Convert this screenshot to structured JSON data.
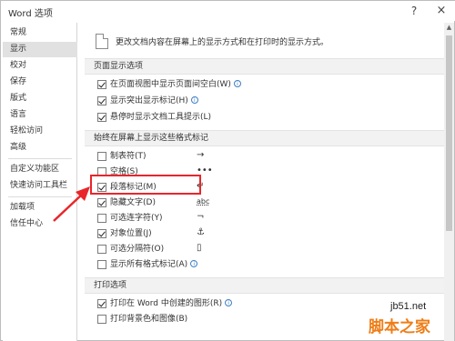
{
  "window": {
    "title": "Word 选项",
    "help_glyph": "?",
    "close_glyph": "×"
  },
  "sidebar": {
    "items": [
      {
        "label": "常规",
        "active": false
      },
      {
        "label": "显示",
        "active": true
      },
      {
        "label": "校对",
        "active": false
      },
      {
        "label": "保存",
        "active": false
      },
      {
        "label": "版式",
        "active": false
      },
      {
        "label": "语言",
        "active": false
      },
      {
        "label": "轻松访问",
        "active": false
      },
      {
        "label": "高级",
        "active": false
      },
      {
        "label": "自定义功能区",
        "active": false
      },
      {
        "label": "快速访问工具栏",
        "active": false
      },
      {
        "label": "加载项",
        "active": false
      },
      {
        "label": "信任中心",
        "active": false
      }
    ]
  },
  "content": {
    "intro": "更改文档内容在屏幕上的显示方式和在打印时的显示方式。",
    "sections": {
      "page_display": {
        "title": "页面显示选项",
        "options": [
          {
            "label": "在页面视图中显示页面间空白(W)",
            "checked": true,
            "info": true
          },
          {
            "label": "显示突出显示标记(H)",
            "checked": true,
            "info": true
          },
          {
            "label": "悬停时显示文档工具提示(L)",
            "checked": true,
            "info": false
          }
        ]
      },
      "format_marks": {
        "title": "始终在屏幕上显示这些格式标记",
        "options": [
          {
            "label": "制表符(T)",
            "checked": false,
            "symbol": "→"
          },
          {
            "label": "空格(S)",
            "checked": false,
            "symbol": "•••"
          },
          {
            "label": "段落标记(M)",
            "checked": true,
            "symbol": "↵"
          },
          {
            "label": "隐藏文字(D)",
            "checked": true,
            "symbol": "abc"
          },
          {
            "label": "可选连字符(Y)",
            "checked": false,
            "symbol": "¬"
          },
          {
            "label": "对象位置(J)",
            "checked": true,
            "symbol": "⚓"
          },
          {
            "label": "可选分隔符(O)",
            "checked": false,
            "symbol": "▯"
          },
          {
            "label": "显示所有格式标记(A)",
            "checked": false,
            "info": true
          }
        ]
      },
      "print": {
        "title": "打印选项",
        "options": [
          {
            "label": "打印在 Word 中创建的图形(R)",
            "checked": true,
            "info": true
          },
          {
            "label": "打印背景色和图像(B)",
            "checked": false,
            "info": false
          }
        ]
      }
    }
  },
  "watermark": {
    "url": "jb51.net",
    "name": "脚本之家"
  },
  "colors": {
    "highlight_border": "#e8262b",
    "arrow": "#e8262b",
    "active_nav": "#e1e1e1",
    "section_bg": "#f2f2f2",
    "watermark": "#ef7d16",
    "info_icon": "#3f7fc6"
  }
}
